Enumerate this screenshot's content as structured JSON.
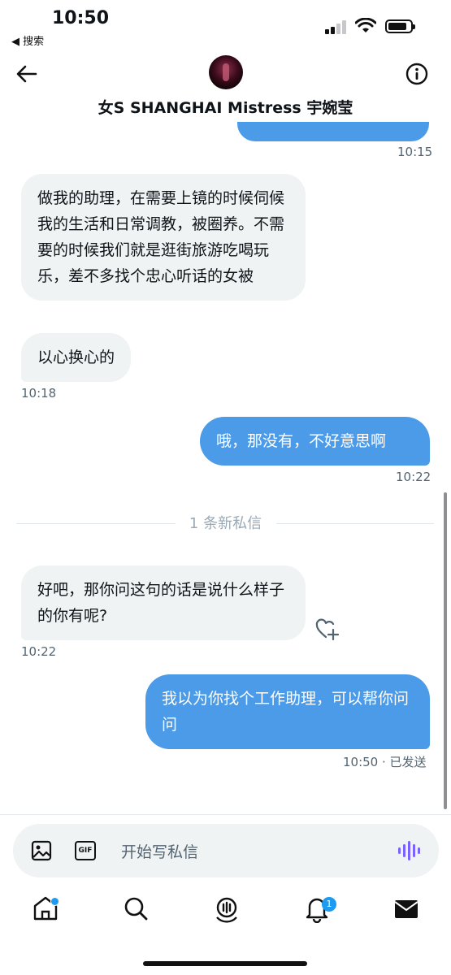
{
  "status_bar": {
    "time": "10:50",
    "back_app": "◀ 搜索"
  },
  "header": {
    "contact_name": "女S SHANGHAI Mistress 宇婉莹"
  },
  "messages": [
    {
      "from": "me",
      "time": "10:15"
    },
    {
      "from": "them",
      "text": "做我的助理，在需要上镜的时候伺候我的生活和日常调教，被圈养。不需要的时候我们就是逛街旅游吃喝玩乐，差不多找个忠心听话的女被"
    },
    {
      "from": "them",
      "text": "以心换心的",
      "time": "10:18"
    },
    {
      "from": "me",
      "text": "哦，那没有，不好意思啊",
      "time": "10:22"
    },
    {
      "from": "them",
      "text": "好吧，那你问这句的话是说什么样子的你有呢?",
      "time": "10:22"
    },
    {
      "from": "me",
      "text": "我以为你找个工作助理，可以帮你问问",
      "time": "10:50 · 已发送"
    }
  ],
  "divider": {
    "label": "1 条新私信"
  },
  "composer": {
    "placeholder": "开始写私信",
    "gif_label": "GIF"
  },
  "tabbar": {
    "items": [
      {
        "icon": "home-icon",
        "label": "首页"
      },
      {
        "icon": "search-icon",
        "label": "搜索"
      },
      {
        "icon": "spaces-icon",
        "label": "空间"
      },
      {
        "icon": "bell-icon",
        "label": "通知",
        "badge": "1"
      },
      {
        "icon": "mail-icon",
        "label": "私信"
      }
    ]
  },
  "colors": {
    "outgoing_bubble": "#4b9be8",
    "incoming_bubble": "#eff3f4",
    "accent": "#1d9bf0"
  }
}
